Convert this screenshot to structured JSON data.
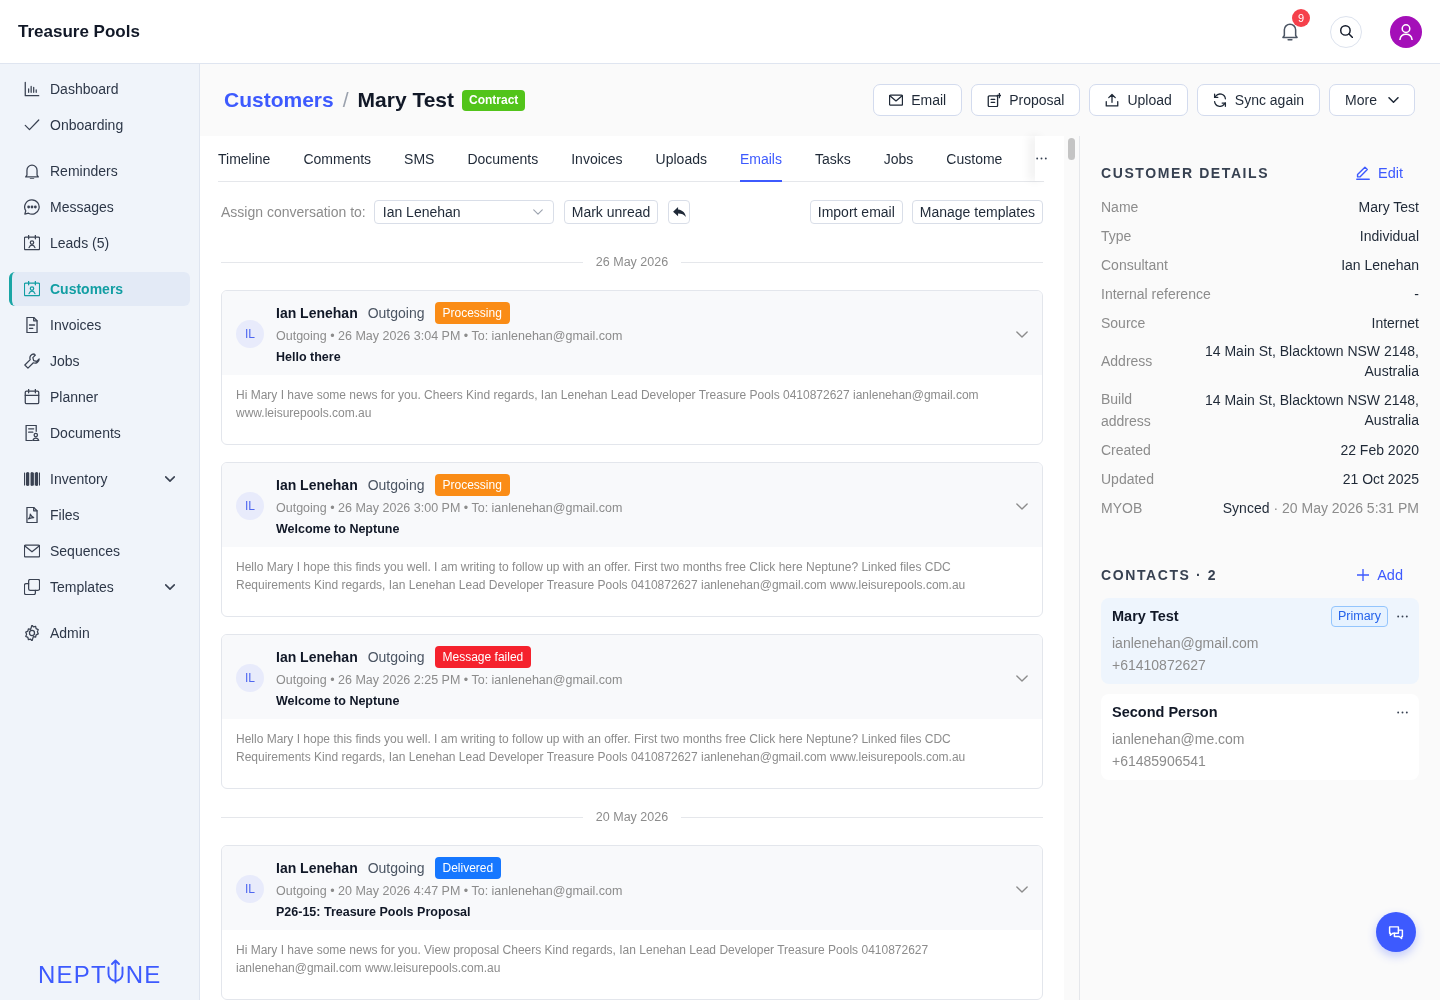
{
  "app": {
    "brand": "Treasure Pools",
    "notification_count": "9"
  },
  "sidebar": {
    "groups": [
      {
        "items": [
          {
            "label": "Dashboard",
            "selected": false,
            "expandable": false
          },
          {
            "label": "Onboarding",
            "selected": false,
            "expandable": false
          }
        ]
      },
      {
        "items": [
          {
            "label": "Reminders",
            "selected": false,
            "expandable": false
          },
          {
            "label": "Messages",
            "selected": false,
            "expandable": false
          },
          {
            "label": "Leads (5)",
            "selected": false,
            "expandable": false
          }
        ]
      },
      {
        "items": [
          {
            "label": "Customers",
            "selected": true,
            "expandable": false
          },
          {
            "label": "Invoices",
            "selected": false,
            "expandable": false
          },
          {
            "label": "Jobs",
            "selected": false,
            "expandable": false
          },
          {
            "label": "Planner",
            "selected": false,
            "expandable": false
          },
          {
            "label": "Documents",
            "selected": false,
            "expandable": false
          }
        ]
      },
      {
        "items": [
          {
            "label": "Inventory",
            "selected": false,
            "expandable": true
          },
          {
            "label": "Files",
            "selected": false,
            "expandable": false
          },
          {
            "label": "Sequences",
            "selected": false,
            "expandable": false
          },
          {
            "label": "Templates",
            "selected": false,
            "expandable": true
          }
        ]
      },
      {
        "items": [
          {
            "label": "Admin",
            "selected": false,
            "expandable": false
          }
        ]
      }
    ],
    "footer_logo": {
      "text_before_icon": "NEPT",
      "text_after_icon": "NE"
    }
  },
  "page_header": {
    "breadcrumb_parent": "Customers",
    "breadcrumb_separator": "/",
    "title": "Mary Test",
    "status_badge": "Contract",
    "actions": [
      {
        "label": "Email",
        "has_menu": false
      },
      {
        "label": "Proposal",
        "has_menu": false
      },
      {
        "label": "Upload",
        "has_menu": false
      },
      {
        "label": "Sync again",
        "has_menu": false
      },
      {
        "label": "More",
        "has_menu": true
      }
    ]
  },
  "tabs": [
    {
      "label": "Timeline",
      "selected": false
    },
    {
      "label": "Comments",
      "selected": false
    },
    {
      "label": "SMS",
      "selected": false
    },
    {
      "label": "Documents",
      "selected": false
    },
    {
      "label": "Invoices",
      "selected": false
    },
    {
      "label": "Uploads",
      "selected": false
    },
    {
      "label": "Emails",
      "selected": true
    },
    {
      "label": "Tasks",
      "selected": false
    },
    {
      "label": "Jobs",
      "selected": false
    },
    {
      "label": "Custome",
      "selected": false
    }
  ],
  "email_toolbar": {
    "assign_label": "Assign conversation to:",
    "assignee": "Ian Lenehan",
    "left_buttons": [
      "Mark unread"
    ],
    "right_buttons": [
      "Import email",
      "Manage templates"
    ]
  },
  "email_groups": [
    {
      "date": "26 May 2026",
      "emails": [
        {
          "initials": "IL",
          "sender": "Ian Lenehan",
          "direction": "Outgoing",
          "status": {
            "label": "Processing",
            "color": "#fa8c16"
          },
          "meta": "Outgoing • 26 May 2026 3:04 PM • To: ianlenehan@gmail.com",
          "subject": "Hello there",
          "preview": "Hi Mary I have some news for you. Cheers Kind regards, Ian Lenehan Lead Developer Treasure Pools 0410872627 ianlenehan@gmail.com www.leisurepools.com.au"
        },
        {
          "initials": "IL",
          "sender": "Ian Lenehan",
          "direction": "Outgoing",
          "status": {
            "label": "Processing",
            "color": "#fa8c16"
          },
          "meta": "Outgoing • 26 May 2026 3:00 PM • To: ianlenehan@gmail.com",
          "subject": "Welcome to Neptune",
          "preview": "Hello Mary I hope this finds you well. I am writing to follow up with an offer. First two months free Click here Neptune? Linked files CDC Requirements Kind regards, Ian Lenehan Lead Developer Treasure Pools 0410872627 ianlenehan@gmail.com www.leisurepools.com.au"
        },
        {
          "initials": "IL",
          "sender": "Ian Lenehan",
          "direction": "Outgoing",
          "status": {
            "label": "Message failed",
            "color": "#f5222d"
          },
          "meta": "Outgoing • 26 May 2026 2:25 PM • To: ianlenehan@gmail.com",
          "subject": "Welcome to Neptune",
          "preview": "Hello Mary I hope this finds you well. I am writing to follow up with an offer. First two months free Click here Neptune? Linked files CDC Requirements Kind regards, Ian Lenehan Lead Developer Treasure Pools 0410872627 ianlenehan@gmail.com www.leisurepools.com.au"
        }
      ]
    },
    {
      "date": "20 May 2026",
      "emails": [
        {
          "initials": "IL",
          "sender": "Ian Lenehan",
          "direction": "Outgoing",
          "status": {
            "label": "Delivered",
            "color": "#1677ff"
          },
          "meta": "Outgoing • 20 May 2026 4:47 PM • To: ianlenehan@gmail.com",
          "subject": "P26-15: Treasure Pools Proposal",
          "preview": "Hi Mary I have some news for you. View proposal Cheers Kind regards, Ian Lenehan Lead Developer Treasure Pools 0410872627 ianlenehan@gmail.com www.leisurepools.com.au"
        }
      ]
    }
  ],
  "customer_details": {
    "heading": "CUSTOMER DETAILS",
    "edit_label": "Edit",
    "fields": [
      {
        "label": "Name",
        "value": "Mary Test"
      },
      {
        "label": "Type",
        "value": "Individual"
      },
      {
        "label": "Consultant",
        "value": "Ian Lenehan"
      },
      {
        "label": "Internal reference",
        "value": "-"
      },
      {
        "label": "Source",
        "value": "Internet"
      },
      {
        "label": "Address",
        "value": "14 Main St, Blacktown NSW 2148, Australia"
      },
      {
        "label": "Build address",
        "value": "14 Main St, Blacktown NSW 2148, Australia"
      },
      {
        "label": "Created",
        "value": "22 Feb 2020"
      },
      {
        "label": "Updated",
        "value": "21 Oct 2025"
      },
      {
        "label": "MYOB",
        "value": "Synced",
        "note": "· 20 May 2026 5:31 PM"
      }
    ]
  },
  "contacts": {
    "heading": "CONTACTS · 2",
    "add_label": "Add",
    "items": [
      {
        "name": "Mary Test",
        "badge": "Primary",
        "highlighted": true,
        "email": "ianlenehan@gmail.com",
        "phone": "+61410872627"
      },
      {
        "name": "Second Person",
        "highlighted": false,
        "email": "ianlenehan@me.com",
        "phone": "+61485906541"
      }
    ]
  }
}
